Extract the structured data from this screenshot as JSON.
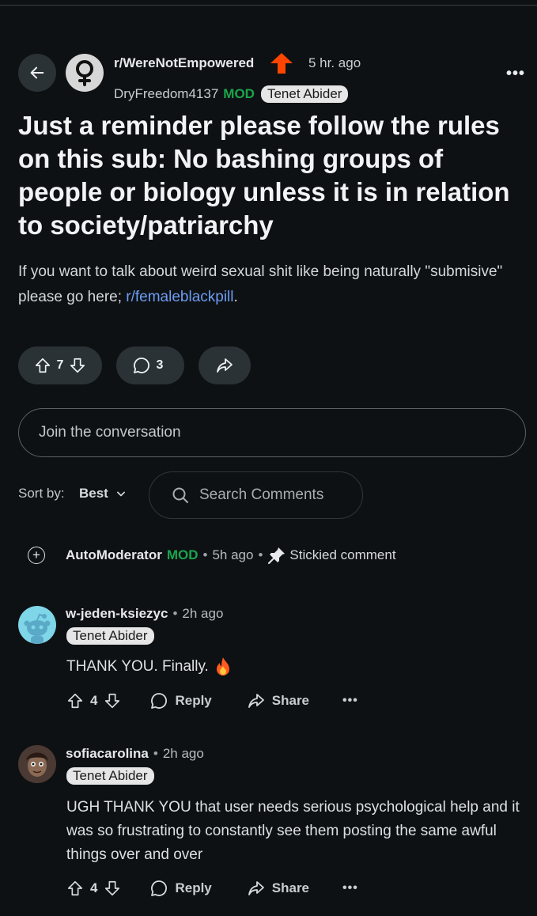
{
  "post": {
    "subreddit": "r/WereNotEmpowered",
    "time": "5 hr. ago",
    "author": "DryFreedom4137",
    "mod_tag": "MOD",
    "flair": "Tenet Abider",
    "title": "Just a reminder please follow the rules on this sub: No bashing groups of people or biology unless it is in relation to society/patriarchy",
    "body_prefix": "If you want to talk about weird sexual shit like being naturally \"submisive\" please go here; ",
    "body_link": "r/femaleblackpill",
    "body_suffix": ".",
    "votes": "7",
    "comments": "3"
  },
  "join_placeholder": "Join the conversation",
  "sort": {
    "label": "Sort by:",
    "value": "Best"
  },
  "search_placeholder": "Search Comments",
  "automod": {
    "name": "AutoModerator",
    "mod_tag": "MOD",
    "time": "5h ago",
    "sticky": "Stickied comment"
  },
  "comments": [
    {
      "user": "w-jeden-ksiezyc",
      "time": "2h ago",
      "flair": "Tenet Abider",
      "text": "THANK YOU. Finally.",
      "votes": "4",
      "reply": "Reply",
      "share": "Share"
    },
    {
      "user": "sofiacarolina",
      "time": "2h ago",
      "flair": "Tenet Abider",
      "text": "UGH THANK YOU that user needs serious psychological help and it was so frustrating to constantly see them posting the same awful things over and over",
      "votes": "4",
      "reply": "Reply",
      "share": "Share"
    }
  ],
  "colors": {
    "background": "#0e1113",
    "mod_green": "#1aa54d",
    "link_blue": "#6c9df5",
    "upvote_orange": "#ff4500",
    "pill_bg": "#2a3236"
  }
}
